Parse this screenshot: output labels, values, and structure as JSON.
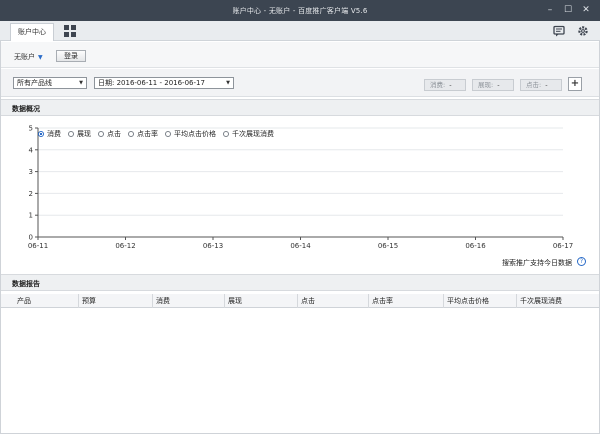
{
  "window": {
    "title": "账户中心 - 无账户 - 百度推广客户端 V5.6",
    "minimize": "–",
    "maximize": "☐",
    "close": "✕"
  },
  "tabs": {
    "active_label": "账户中心"
  },
  "account": {
    "selected": "无账户",
    "login_label": "登录"
  },
  "filters": {
    "product_line": "所有产品线",
    "date_range": "日期: 2016-06-11 - 2016-06-17",
    "stats": [
      {
        "label": "消费:",
        "value": "-"
      },
      {
        "label": "展现:",
        "value": "-"
      },
      {
        "label": "点击:",
        "value": "-"
      }
    ],
    "add_label": "+"
  },
  "overview": {
    "title": "数据概况",
    "legend": [
      {
        "label": "消费",
        "selected": true
      },
      {
        "label": "展现",
        "selected": false
      },
      {
        "label": "点击",
        "selected": false
      },
      {
        "label": "点击率",
        "selected": false
      },
      {
        "label": "平均点击价格",
        "selected": false
      },
      {
        "label": "千次展现消费",
        "selected": false
      }
    ],
    "note": "搜索推广支持今日数据",
    "help": "?"
  },
  "chart_data": {
    "type": "line",
    "categories": [
      "06-11",
      "06-12",
      "06-13",
      "06-14",
      "06-15",
      "06-16",
      "06-17"
    ],
    "yticks": [
      "0",
      "1",
      "2",
      "3",
      "4",
      "5"
    ],
    "ylim": [
      0,
      5
    ],
    "series": [],
    "grid": true,
    "legend": "top-left"
  },
  "report": {
    "title": "数据报告",
    "columns": [
      "产品",
      "预算",
      "消费",
      "展现",
      "点击",
      "点击率",
      "平均点击价格",
      "千次展现消费"
    ]
  },
  "colors": {
    "titlebar": "#3c4551",
    "accent": "#2b6cc8",
    "grid": "#e6e8eb"
  }
}
